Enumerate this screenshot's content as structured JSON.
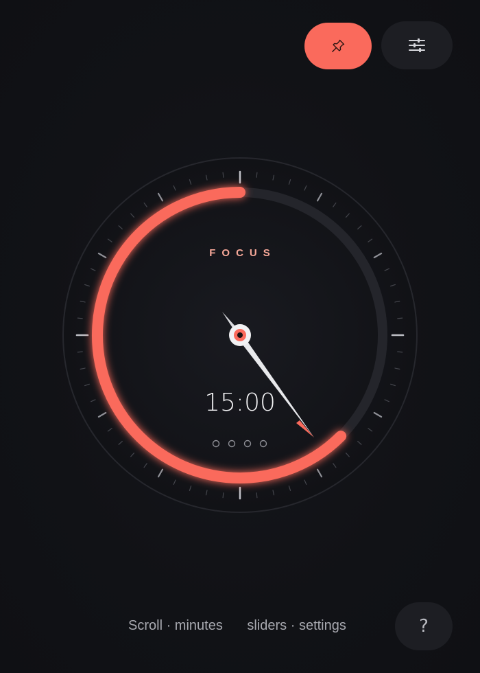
{
  "mode": {
    "label": "FOCUS"
  },
  "timer": {
    "display": "15:00",
    "progress": 0.625,
    "session_dots": 4
  },
  "toolbar": {
    "pin_icon": "pin-icon",
    "settings_icon": "sliders-icon"
  },
  "help": {
    "label": "?"
  },
  "hints": {
    "scroll": "Scroll · minutes",
    "sliders": "sliders · settings"
  },
  "colors": {
    "accent": "#fa6a5c",
    "background": "#111216",
    "track": "#24252b",
    "button_dark": "#1d1e23"
  }
}
